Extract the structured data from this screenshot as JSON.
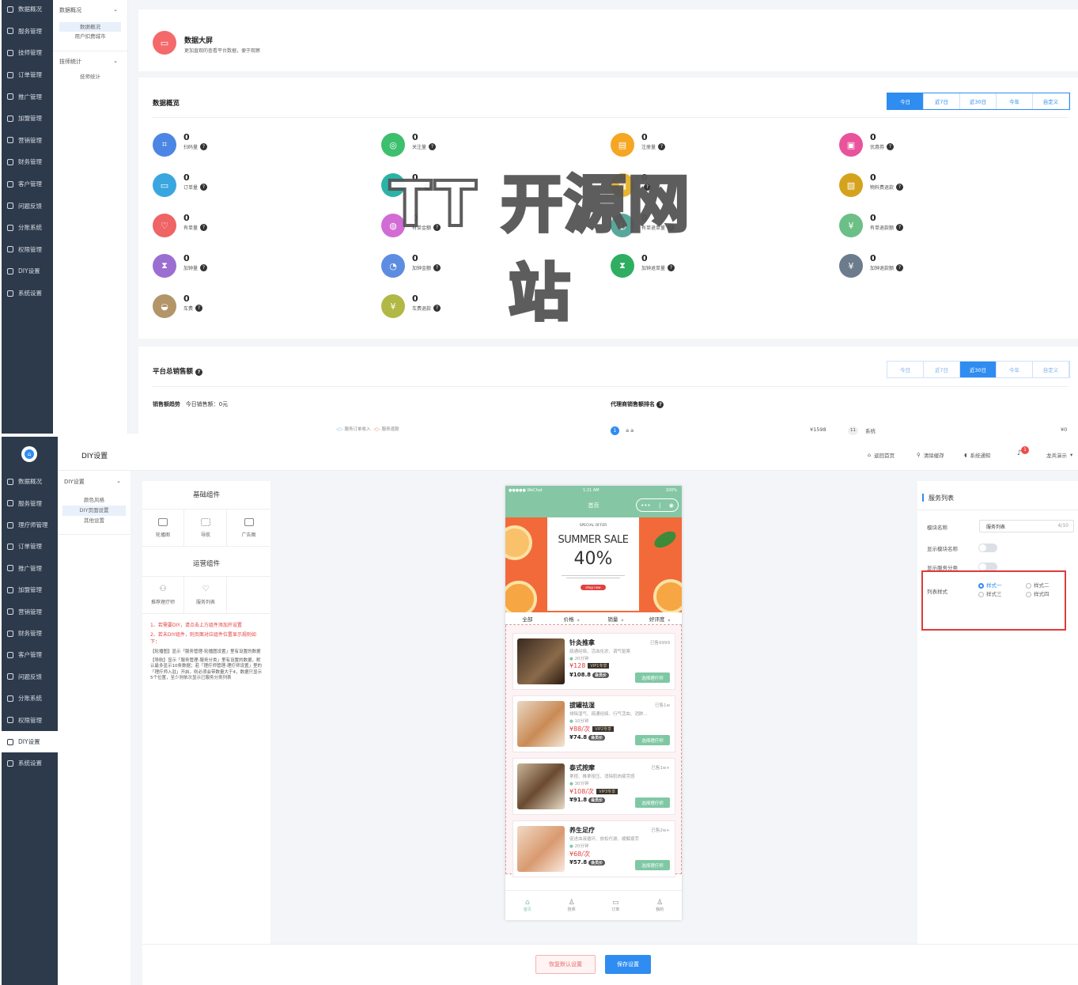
{
  "top": {
    "sidebar": [
      {
        "label": "数据概况"
      },
      {
        "label": "服务管理"
      },
      {
        "label": "技师管理"
      },
      {
        "label": "订单管理"
      },
      {
        "label": "推广管理"
      },
      {
        "label": "加盟管理"
      },
      {
        "label": "营销管理"
      },
      {
        "label": "财务管理"
      },
      {
        "label": "客户管理"
      },
      {
        "label": "问题反馈"
      },
      {
        "label": "分账系统"
      },
      {
        "label": "权限管理"
      },
      {
        "label": "DIY设置"
      },
      {
        "label": "系统设置"
      }
    ],
    "submenu": {
      "group1_title": "数据概况",
      "group1_items": [
        "数据概况",
        "用户扣费城市"
      ],
      "group2_title": "技师统计",
      "group2_items": [
        "技师统计"
      ]
    },
    "banner": {
      "title": "数据大屏",
      "desc": "更加直观的查看平台数据，便于观察"
    },
    "overview": {
      "title": "数据概览",
      "tabs": [
        "今日",
        "近7日",
        "近30日",
        "今年",
        "自定义"
      ],
      "active_tab": 0,
      "stats": [
        {
          "value": "0",
          "label": "扫码量",
          "color": "#4b86e5",
          "icon": "⌗"
        },
        {
          "value": "0",
          "label": "关注量",
          "color": "#3dbf6e",
          "icon": "◎"
        },
        {
          "value": "0",
          "label": "注册量",
          "color": "#f5a623",
          "icon": "▤"
        },
        {
          "value": "0",
          "label": "优惠券",
          "color": "#e8539c",
          "icon": "▣"
        },
        {
          "value": "0",
          "label": "订单量",
          "color": "#3aa6e0",
          "icon": "▭"
        },
        {
          "value": "0",
          "label": "销量",
          "color": "#2ab3a6",
          "icon": "◷"
        },
        {
          "value": "0",
          "label": "",
          "color": "#e7b532",
          "icon": "▦"
        },
        {
          "value": "0",
          "label": "物料费退款",
          "color": "#d5a21e",
          "icon": "▧"
        },
        {
          "value": "0",
          "label": "有单量",
          "color": "#ef6464",
          "icon": "♡"
        },
        {
          "value": "0",
          "label": "有单金额",
          "color": "#d36bd4",
          "icon": "◍"
        },
        {
          "value": "0",
          "label": "有单退单量",
          "color": "#59a79a",
          "icon": "◐"
        },
        {
          "value": "0",
          "label": "有单退款额",
          "color": "#6bbf87",
          "icon": "¥"
        },
        {
          "value": "0",
          "label": "加钟量",
          "color": "#9b6ed1",
          "icon": "⧗"
        },
        {
          "value": "0",
          "label": "加钟金额",
          "color": "#5c8de0",
          "icon": "◔"
        },
        {
          "value": "0",
          "label": "加钟退单量",
          "color": "#2fae62",
          "icon": "⧗"
        },
        {
          "value": "0",
          "label": "加钟退款额",
          "color": "#6d7c8c",
          "icon": "¥"
        },
        {
          "value": "0",
          "label": "车费",
          "color": "#b39569",
          "icon": "◒"
        },
        {
          "value": "0",
          "label": "车费退款",
          "color": "#b1b845",
          "icon": "¥"
        }
      ]
    },
    "sales": {
      "title": "平台总销售额",
      "tabs": [
        "今日",
        "近7日",
        "近30日",
        "今年",
        "自定义"
      ],
      "active_tab": 2,
      "trend_label": "销售额趋势",
      "today_sales": "今日销售额：0元",
      "legend": [
        "服务订单收入",
        "服务退款"
      ],
      "rank_title": "代理商销售额排名",
      "rank_rows": [
        {
          "rank": "1",
          "name": "a a",
          "amount": "¥1598"
        },
        {
          "rank": "11",
          "name": "系统",
          "amount": "¥0"
        }
      ]
    },
    "watermark": "TT 开源网站"
  },
  "bottom": {
    "sidebar": [
      {
        "label": "数据概况"
      },
      {
        "label": "服务管理"
      },
      {
        "label": "理疗师管理"
      },
      {
        "label": "订单管理"
      },
      {
        "label": "推广管理"
      },
      {
        "label": "加盟管理"
      },
      {
        "label": "营销管理"
      },
      {
        "label": "财务管理"
      },
      {
        "label": "客户管理"
      },
      {
        "label": "问题反馈"
      },
      {
        "label": "分账系统"
      },
      {
        "label": "权限管理"
      },
      {
        "label": "DIY设置"
      },
      {
        "label": "系统设置"
      }
    ],
    "active_index": 12,
    "page_title": "DIY设置",
    "topbar": [
      "返回首页",
      "清除缓存",
      "系统通知",
      "龙兵演示"
    ],
    "badge": "1",
    "submenu": {
      "title": "DIY设置",
      "items": [
        "颜色风格",
        "DIY页面设置",
        "其他设置"
      ],
      "active": 1
    },
    "components": {
      "basic_title": "基础组件",
      "basic": [
        "轮播图",
        "导航",
        "广告图"
      ],
      "ops_title": "运营组件",
      "ops": [
        "推荐理疗师",
        "服务列表"
      ],
      "notes_red": [
        "1、若需要DIY，请点击上方组件添加开设置",
        "2、若未DIY组件，则页面对应组件位置显示规则如下："
      ],
      "notes_blue": [
        "【轮播图】显示「服务管理-轮播图设置」里有设置的数据",
        "【导航】显示「服务管理-服务分类」里有设置的数据，默认最多显示10条数据；若「理疗师管理-理疗师设置」里的「理疗师入驻」开启，则必须会带数量大于4，数据只显示5个位置，至少则依次显示已服务分类列表"
      ]
    },
    "phone": {
      "status_left": "●●●●● WeChat",
      "status_time": "1:21 AM",
      "status_right": "100%",
      "nav_title": "首页",
      "promo": {
        "top": "SPECIAL OFFER",
        "title": "SUMMER SALE",
        "pct": "40%",
        "btn": "shop now"
      },
      "filters": [
        "全部",
        "价格",
        "销量",
        "好评度"
      ],
      "services": [
        {
          "name": "针灸推拿",
          "sold": "已售9999",
          "desc": "疏通经络、活血化淤、调气驱寒",
          "time": "20分钟",
          "price": "¥128",
          "vip": "VIP1专享",
          "vprice": "¥108.8",
          "vtag": "会员价",
          "btn": "选择理疗师",
          "bg": "linear-gradient(135deg,#3a2a20,#8a6a4a 60%,#2a1a10)"
        },
        {
          "name": "拔罐祛湿",
          "sold": "已售1w",
          "desc": "排除湿气、疏通经络、行气活血、消肿...",
          "time": "10分钟",
          "price": "¥88/次",
          "vip": "VIP2专享",
          "vprice": "¥74.8",
          "vtag": "会员价",
          "btn": "选择理疗师",
          "bg": "linear-gradient(135deg,#e9d7c2,#c98a55 55%,#f3e6d5)"
        },
        {
          "name": "泰式按摩",
          "sold": "已售1w+",
          "desc": "拿捏、推拿按压、消除肌肉疲劳感",
          "time": "30分钟",
          "price": "¥108/次",
          "vip": "VIP3专享",
          "vprice": "¥91.8",
          "vtag": "会员价",
          "btn": "选择理疗师",
          "bg": "linear-gradient(135deg,#c8b49a,#6a4a30 50%,#e8dcc8)"
        },
        {
          "name": "养生足疗",
          "sold": "已售2w+",
          "desc": "促进血液循环、放松代谢、缓解疲劳",
          "time": "20分钟",
          "price": "¥68/次",
          "vip": "",
          "vprice": "¥57.8",
          "vtag": "会员价",
          "btn": "选择理疗师",
          "bg": "linear-gradient(135deg,#f2d8c4,#d89a70 55%,#fbe9dc)"
        }
      ],
      "tabbar": [
        "首页",
        "技师",
        "订单",
        "我的"
      ]
    },
    "settings": {
      "title": "服务列表",
      "name_label": "模块名称",
      "name_value": "服务列表",
      "name_count": "4/10",
      "show_name_label": "显示模块名称",
      "show_cat_label": "显示服务分类",
      "style_label": "列表样式",
      "styles": [
        "样式一",
        "样式二",
        "样式三",
        "样式四"
      ],
      "active_style": 0
    },
    "buttons": {
      "reset": "恢复默认设置",
      "save": "保存设置"
    }
  }
}
